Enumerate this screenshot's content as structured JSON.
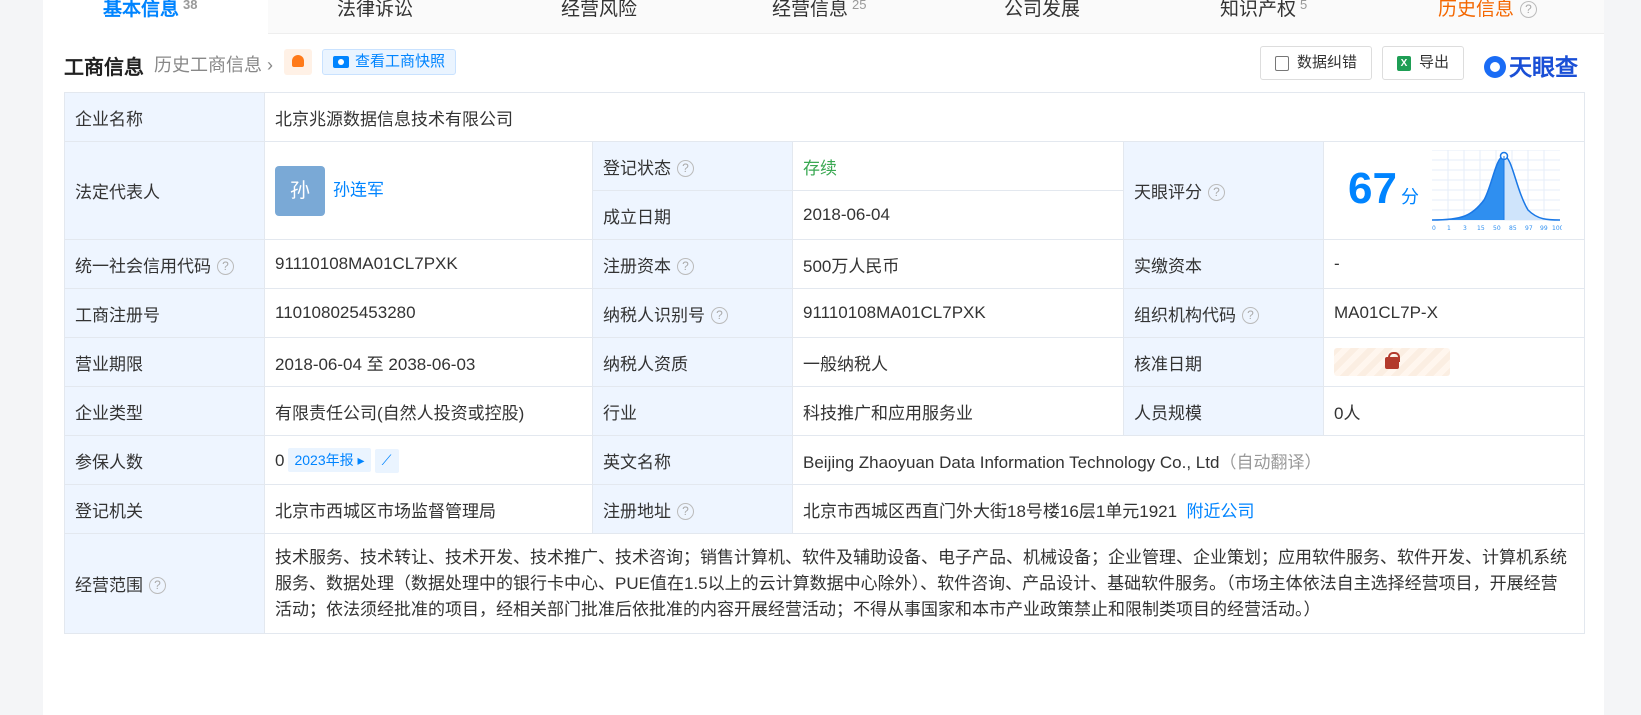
{
  "tabs": [
    {
      "label": "基本信息",
      "count": "38",
      "active": true
    },
    {
      "label": "法律诉讼",
      "count": ""
    },
    {
      "label": "经营风险",
      "count": ""
    },
    {
      "label": "经营信息",
      "count": "25"
    },
    {
      "label": "公司发展",
      "count": ""
    },
    {
      "label": "知识产权",
      "count": "5"
    },
    {
      "label": "历史信息",
      "count": ""
    }
  ],
  "header": {
    "title": "工商信息",
    "history_link": "历史工商信息",
    "snapshot_label": "查看工商快照",
    "correct_label": "数据纠错",
    "export_label": "导出",
    "logo_text": "天眼查"
  },
  "info": {
    "company_name_label": "企业名称",
    "company_name": "北京兆源数据信息技术有限公司",
    "legal_rep_label": "法定代表人",
    "legal_rep_avatar": "孙",
    "legal_rep_name": "孙连军",
    "reg_status_label": "登记状态",
    "reg_status": "存续",
    "found_date_label": "成立日期",
    "found_date": "2018-06-04",
    "score_label": "天眼评分",
    "score_value": "67",
    "score_unit": "分",
    "score_ticks": [
      "0",
      "1",
      "3",
      "15",
      "50",
      "85",
      "97",
      "99",
      "100"
    ],
    "credit_code_label": "统一社会信用代码",
    "credit_code": "91110108MA01CL7PXK",
    "reg_capital_label": "注册资本",
    "reg_capital": "500万人民币",
    "paid_capital_label": "实缴资本",
    "paid_capital": "-",
    "biz_reg_no_label": "工商注册号",
    "biz_reg_no": "110108025453280",
    "taxpayer_id_label": "纳税人识别号",
    "taxpayer_id": "91110108MA01CL7PXK",
    "org_code_label": "组织机构代码",
    "org_code": "MA01CL7P-X",
    "term_label": "营业期限",
    "term": "2018-06-04 至 2038-06-03",
    "tax_qual_label": "纳税人资质",
    "tax_qual": "一般纳税人",
    "approve_date_label": "核准日期",
    "type_label": "企业类型",
    "type": "有限责任公司(自然人投资或控股)",
    "industry_label": "行业",
    "industry": "科技推广和应用服务业",
    "staff_label": "人员规模",
    "staff": "0人",
    "insured_label": "参保人数",
    "insured": "0",
    "report_label": "2023年报",
    "en_name_label": "英文名称",
    "en_name": "Beijing Zhaoyuan Data Information Technology Co., Ltd",
    "en_name_note": "（自动翻译）",
    "authority_label": "登记机关",
    "authority": "北京市西城区市场监督管理局",
    "address_label": "注册地址",
    "address": "北京市西城区西直门外大街18号楼16层1单元1921",
    "nearby_label": "附近公司",
    "scope_label": "经营范围",
    "scope": "技术服务、技术转让、技术开发、技术推广、技术咨询；销售计算机、软件及辅助设备、电子产品、机械设备；企业管理、企业策划；应用软件服务、软件开发、计算机系统服务、数据处理（数据处理中的银行卡中心、PUE值在1.5以上的云计算数据中心除外）、软件咨询、产品设计、基础软件服务。（市场主体依法自主选择经营项目，开展经营活动；依法须经批准的项目，经相关部门批准后依批准的内容开展经营活动；不得从事国家和本市产业政策禁止和限制类项目的经营活动。）"
  }
}
